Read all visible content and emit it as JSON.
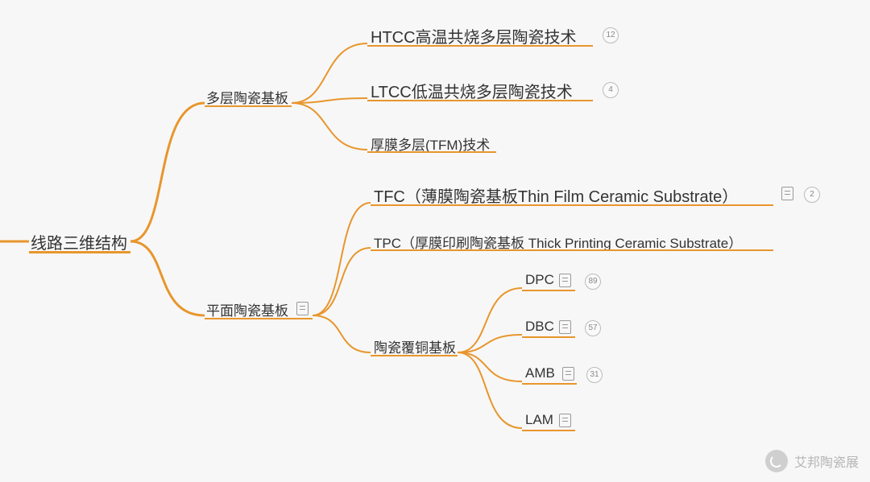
{
  "root": {
    "label": "线路三维结构"
  },
  "branches": {
    "multilayer": {
      "label": "多层陶瓷基板",
      "children": {
        "htcc": {
          "label": "HTCC高温共烧多层陶瓷技术",
          "count": "12"
        },
        "ltcc": {
          "label": "LTCC低温共烧多层陶瓷技术",
          "count": "4"
        },
        "tfm": {
          "label": "厚膜多层(TFM)技术"
        }
      }
    },
    "planar": {
      "label": "平面陶瓷基板",
      "has_doc": true,
      "children": {
        "tfc": {
          "label": "TFC（薄膜陶瓷基板Thin Film Ceramic Substrate）",
          "has_doc": true,
          "count": "2"
        },
        "tpc": {
          "label": "TPC（厚膜印刷陶瓷基板 Thick Printing Ceramic Substrate）"
        },
        "copper": {
          "label": "陶瓷覆铜基板",
          "children": {
            "dpc": {
              "label": "DPC",
              "has_doc": true,
              "count": "89"
            },
            "dbc": {
              "label": "DBC",
              "has_doc": true,
              "count": "57"
            },
            "amb": {
              "label": "AMB",
              "has_doc": true,
              "count": "31"
            },
            "lam": {
              "label": "LAM",
              "has_doc": true
            }
          }
        }
      }
    }
  },
  "watermark": {
    "text": "艾邦陶瓷展"
  },
  "style": {
    "line_color": "#e8962c"
  }
}
